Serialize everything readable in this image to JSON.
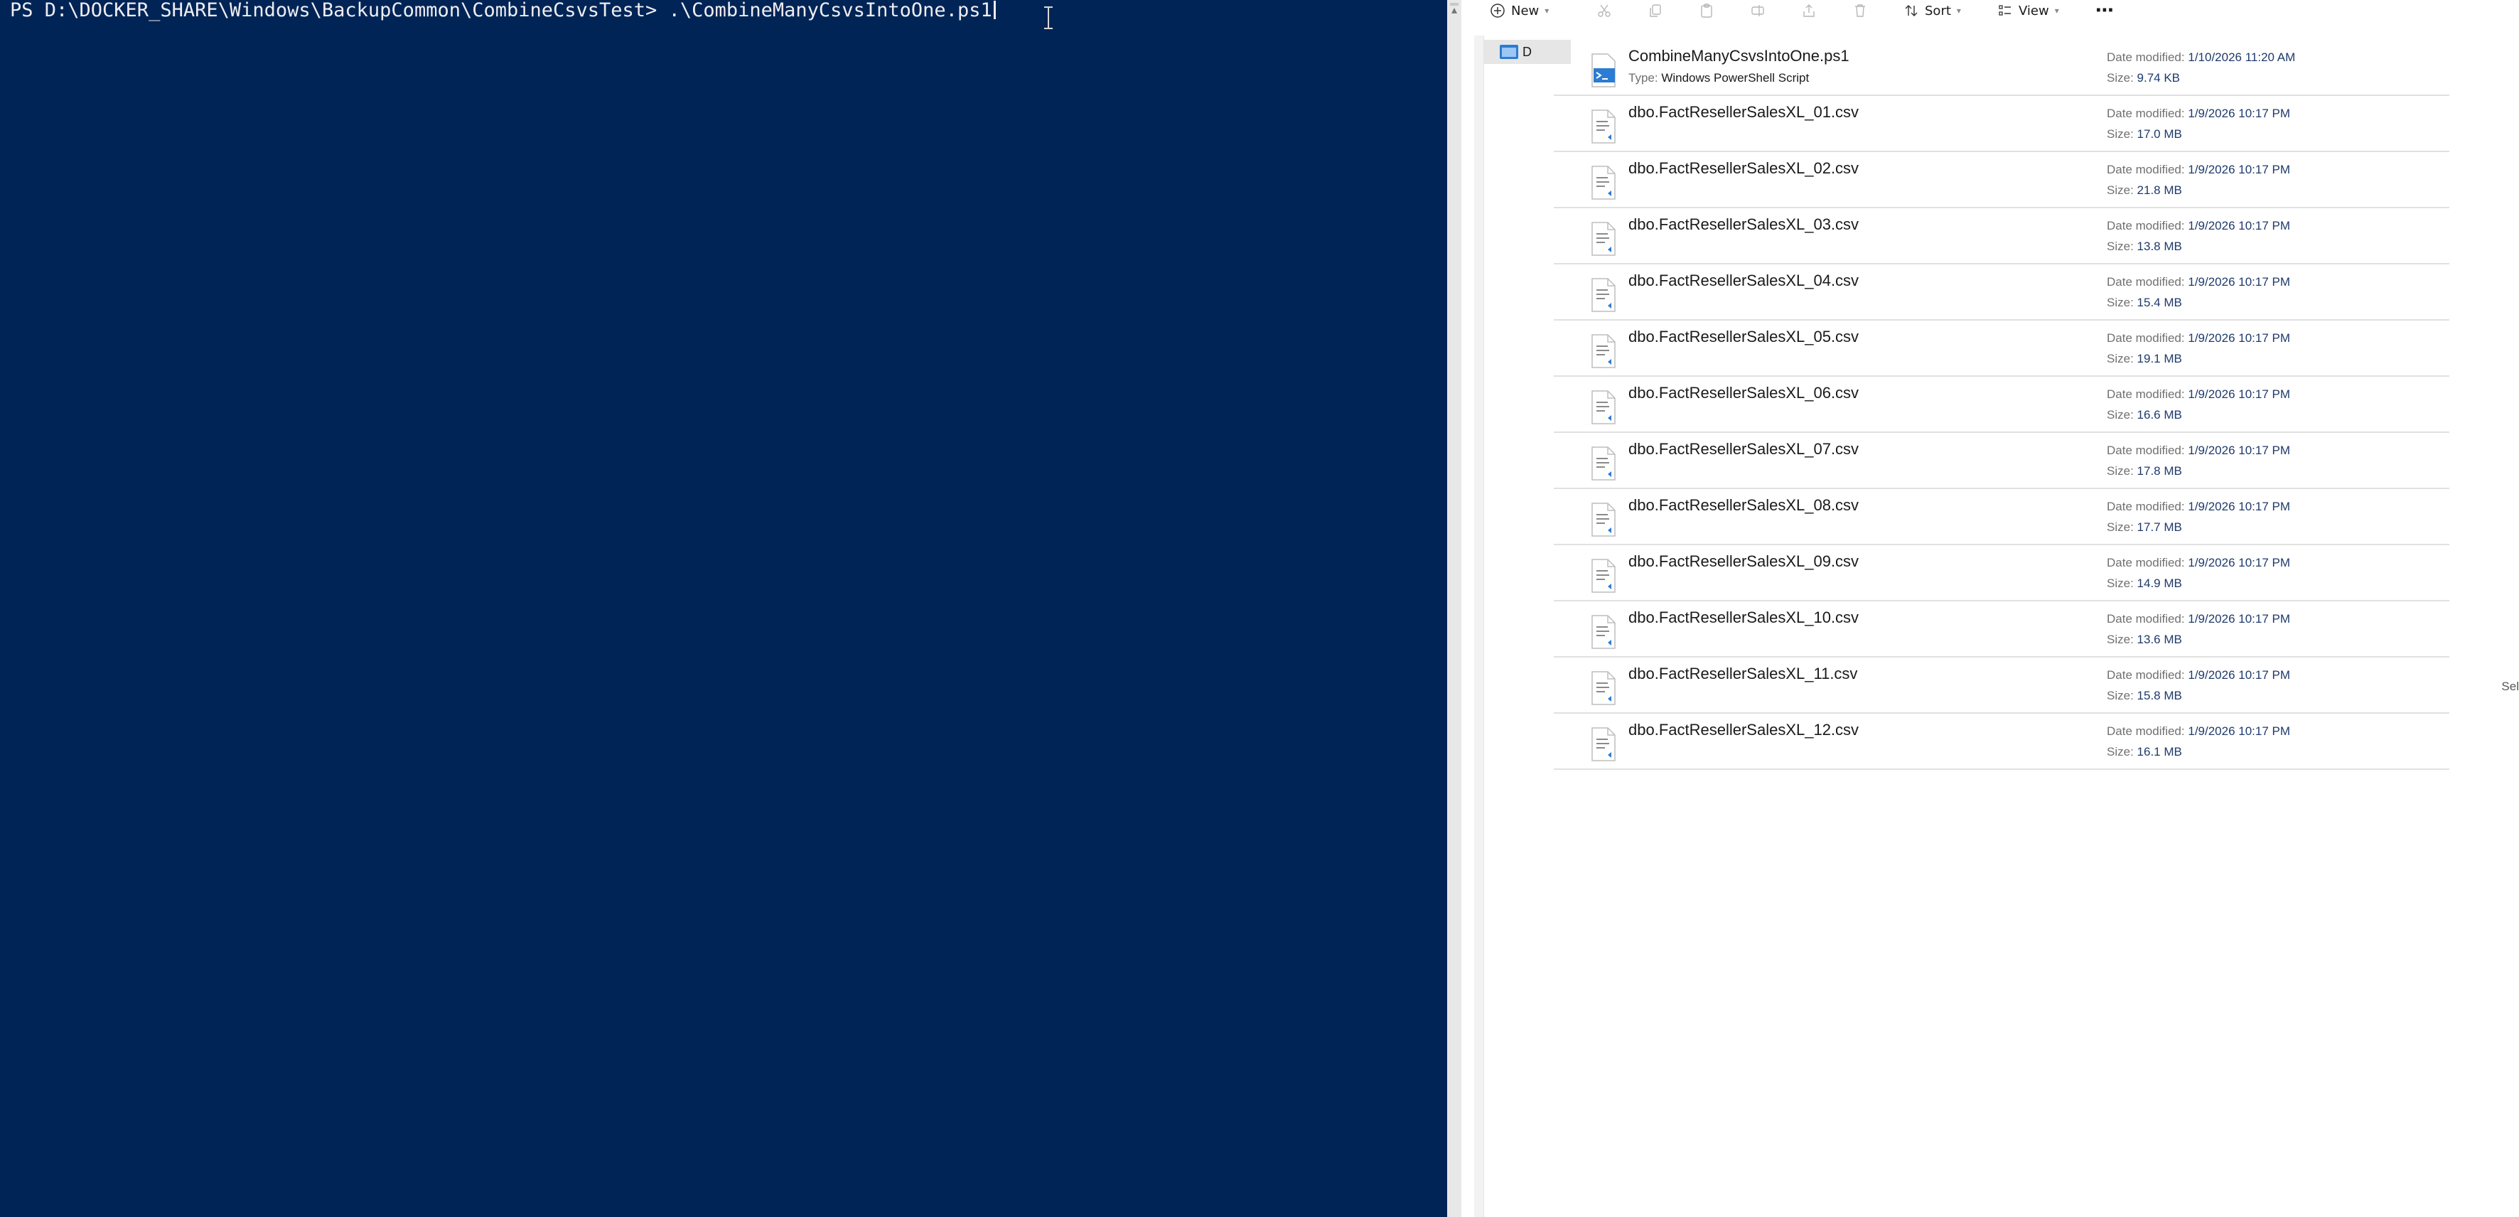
{
  "terminal": {
    "prompt": "PS D:\\DOCKER_SHARE\\Windows\\BackupCommon\\CombineCsvsTest> ",
    "command": ".\\CombineManyCsvsIntoOne.ps1",
    "background": "#012456",
    "foreground": "#eeedf0"
  },
  "toolbar": {
    "new_label": "New",
    "sort_label": "Sort",
    "view_label": "View",
    "more_label": "⋯"
  },
  "nav": {
    "folder_label": "D"
  },
  "labels": {
    "date_modified": "Date modified:",
    "size": "Size:",
    "type": "Type:"
  },
  "files": [
    {
      "name": "CombineManyCsvsIntoOne.ps1",
      "type": "Windows PowerShell Script",
      "date": "1/10/2026 11:20 AM",
      "size": "9.74 KB",
      "icon": "powershell-script-icon"
    },
    {
      "name": "dbo.FactResellerSalesXL_01.csv",
      "date": "1/9/2026 10:17 PM",
      "size": "17.0 MB",
      "icon": "csv-file-icon"
    },
    {
      "name": "dbo.FactResellerSalesXL_02.csv",
      "date": "1/9/2026 10:17 PM",
      "size": "21.8 MB",
      "icon": "csv-file-icon"
    },
    {
      "name": "dbo.FactResellerSalesXL_03.csv",
      "date": "1/9/2026 10:17 PM",
      "size": "13.8 MB",
      "icon": "csv-file-icon"
    },
    {
      "name": "dbo.FactResellerSalesXL_04.csv",
      "date": "1/9/2026 10:17 PM",
      "size": "15.4 MB",
      "icon": "csv-file-icon"
    },
    {
      "name": "dbo.FactResellerSalesXL_05.csv",
      "date": "1/9/2026 10:17 PM",
      "size": "19.1 MB",
      "icon": "csv-file-icon"
    },
    {
      "name": "dbo.FactResellerSalesXL_06.csv",
      "date": "1/9/2026 10:17 PM",
      "size": "16.6 MB",
      "icon": "csv-file-icon"
    },
    {
      "name": "dbo.FactResellerSalesXL_07.csv",
      "date": "1/9/2026 10:17 PM",
      "size": "17.8 MB",
      "icon": "csv-file-icon"
    },
    {
      "name": "dbo.FactResellerSalesXL_08.csv",
      "date": "1/9/2026 10:17 PM",
      "size": "17.7 MB",
      "icon": "csv-file-icon"
    },
    {
      "name": "dbo.FactResellerSalesXL_09.csv",
      "date": "1/9/2026 10:17 PM",
      "size": "14.9 MB",
      "icon": "csv-file-icon"
    },
    {
      "name": "dbo.FactResellerSalesXL_10.csv",
      "date": "1/9/2026 10:17 PM",
      "size": "13.6 MB",
      "icon": "csv-file-icon"
    },
    {
      "name": "dbo.FactResellerSalesXL_11.csv",
      "date": "1/9/2026 10:17 PM",
      "size": "15.8 MB",
      "icon": "csv-file-icon"
    },
    {
      "name": "dbo.FactResellerSalesXL_12.csv",
      "date": "1/9/2026 10:17 PM",
      "size": "16.1 MB",
      "icon": "csv-file-icon"
    }
  ],
  "edge_text": "Sel"
}
